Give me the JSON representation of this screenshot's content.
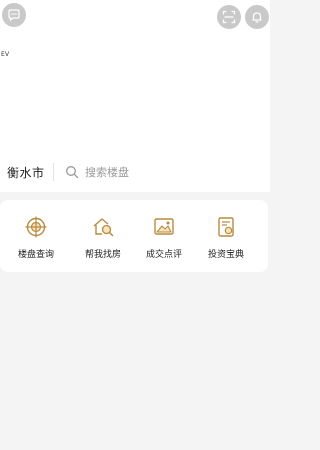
{
  "header": {
    "left_icon": "message-bubble-icon",
    "right_icons": [
      "scan-icon",
      "bell-icon"
    ],
    "ev_label": "EV"
  },
  "search": {
    "city": "衡水市",
    "placeholder": "搜索楼盘"
  },
  "quick_links": [
    {
      "label": "楼盘查询",
      "icon": "target-building-icon"
    },
    {
      "label": "帮我找房",
      "icon": "house-search-icon"
    },
    {
      "label": "成交点评",
      "icon": "image-review-icon"
    },
    {
      "label": "投资宝典",
      "icon": "book-coin-icon"
    }
  ],
  "colors": {
    "accent": "#b98a3e",
    "icon_gray": "#c9c9c9",
    "background": "#f4f4f4"
  }
}
